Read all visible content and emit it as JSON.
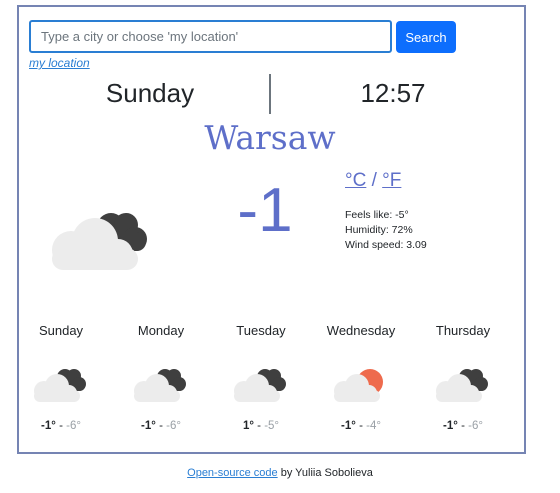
{
  "search": {
    "placeholder": "Type a city or choose 'my location'",
    "value": "",
    "button_label": "Search",
    "my_location_label": "my location"
  },
  "current": {
    "day": "Sunday",
    "time": "12:57",
    "city": "Warsaw",
    "temperature": "-1",
    "icon": "cloudy-night-icon",
    "unit_celsius": "°C",
    "unit_separator": "/",
    "unit_fahrenheit": "°F",
    "feels_like": "Feels like: -5°",
    "humidity": "Humidity: 72%",
    "wind_speed": "Wind speed: 3.09"
  },
  "forecast": [
    {
      "day": "Sunday",
      "max": "-1°",
      "min": "-6°",
      "icon": "cloudy-night-icon"
    },
    {
      "day": "Monday",
      "max": "-1°",
      "min": "-6°",
      "icon": "cloudy-night-icon"
    },
    {
      "day": "Tuesday",
      "max": "1°",
      "min": "-5°",
      "icon": "cloudy-night-icon"
    },
    {
      "day": "Wednesday",
      "max": "-1°",
      "min": "-4°",
      "icon": "partly-sunny-icon"
    },
    {
      "day": "Thursday",
      "max": "-1°",
      "min": "-6°",
      "icon": "cloudy-night-icon"
    }
  ],
  "temp_separator": " - ",
  "footer": {
    "link_text": "Open-source code",
    "suffix": " by Yuliia Sobolieva"
  },
  "colors": {
    "accent": "#5e6fc9",
    "button": "#0d6efd",
    "border": "#7584b3",
    "sun": "#ee6b4d"
  }
}
